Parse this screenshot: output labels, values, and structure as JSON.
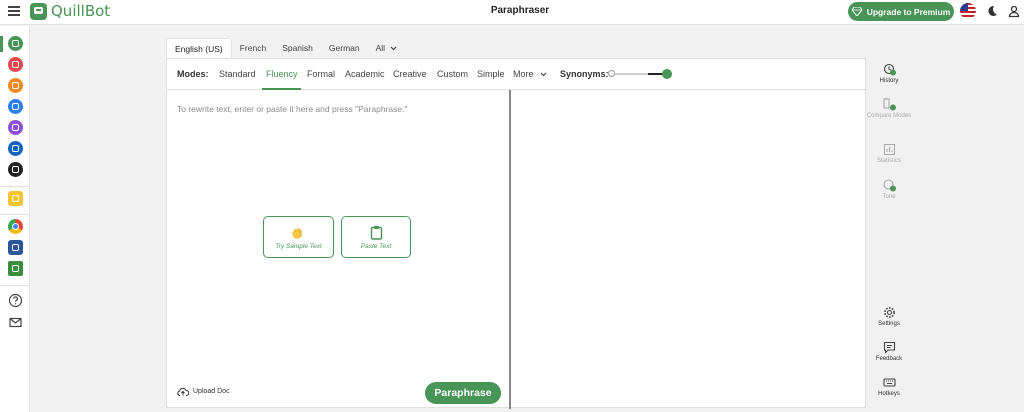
{
  "app": {
    "name": "QuillBot",
    "page_title": "Paraphraser",
    "premium_label": "Upgrade to Premium"
  },
  "languages": [
    "English (US)",
    "French",
    "Spanish",
    "German",
    "All"
  ],
  "modes": {
    "label": "Modes:",
    "items": [
      "Standard",
      "Fluency",
      "Formal",
      "Academic",
      "Creative",
      "Custom",
      "Simple",
      "More"
    ],
    "active": "Fluency"
  },
  "synonyms": {
    "label": "Synonyms:",
    "level": 1.0
  },
  "editor": {
    "placeholder": "To rewrite text, enter or paste it here and press \"Paraphrase.\"",
    "sample_label": "Try Sample Text",
    "paste_label": "Paste Text",
    "upload_label": "Upload Doc",
    "paraphrase_label": "Paraphrase"
  },
  "right_panel": {
    "history": "History",
    "compare": "Compare Modes",
    "statistics": "Statistics",
    "tone": "Tone",
    "settings": "Settings",
    "feedback": "Feedback",
    "hotkeys": "Hotkeys"
  },
  "colors": {
    "brand": "#499557",
    "background": "#f1f1f1"
  },
  "left_rail_icons": [
    "paraphraser-icon",
    "grammar-checker-icon",
    "ai-detector-icon",
    "plagiarism-checker-icon",
    "summarizer-icon",
    "citation-generator-icon",
    "translator-icon",
    "premium-icon",
    "chrome-extension-icon",
    "word-addin-icon",
    "desktop-app-icon",
    "help-icon",
    "mail-icon"
  ]
}
